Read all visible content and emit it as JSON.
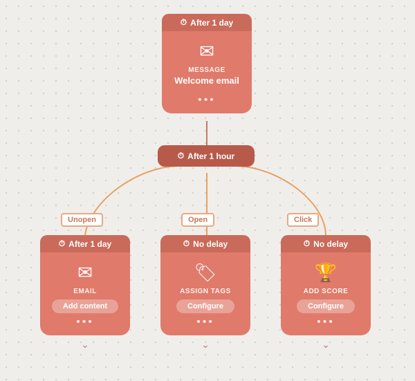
{
  "cards": {
    "top": {
      "delay": "After 1 day",
      "type_label": "MESSAGE",
      "title": "Welcome email",
      "dots": "•••"
    },
    "mid": {
      "delay": "After 1 hour"
    },
    "left": {
      "delay": "After 1 day",
      "type_label": "EMAIL",
      "btn": "Add content",
      "dots": "•••"
    },
    "center": {
      "delay": "No delay",
      "type_label": "ASSIGN TAGS",
      "btn": "Configure",
      "dots": "•••"
    },
    "right": {
      "delay": "No delay",
      "type_label": "ADD SCORE",
      "btn": "Configure",
      "dots": "•••"
    }
  },
  "branch_labels": {
    "left": "Unopen",
    "center": "Open",
    "right": "Click"
  }
}
